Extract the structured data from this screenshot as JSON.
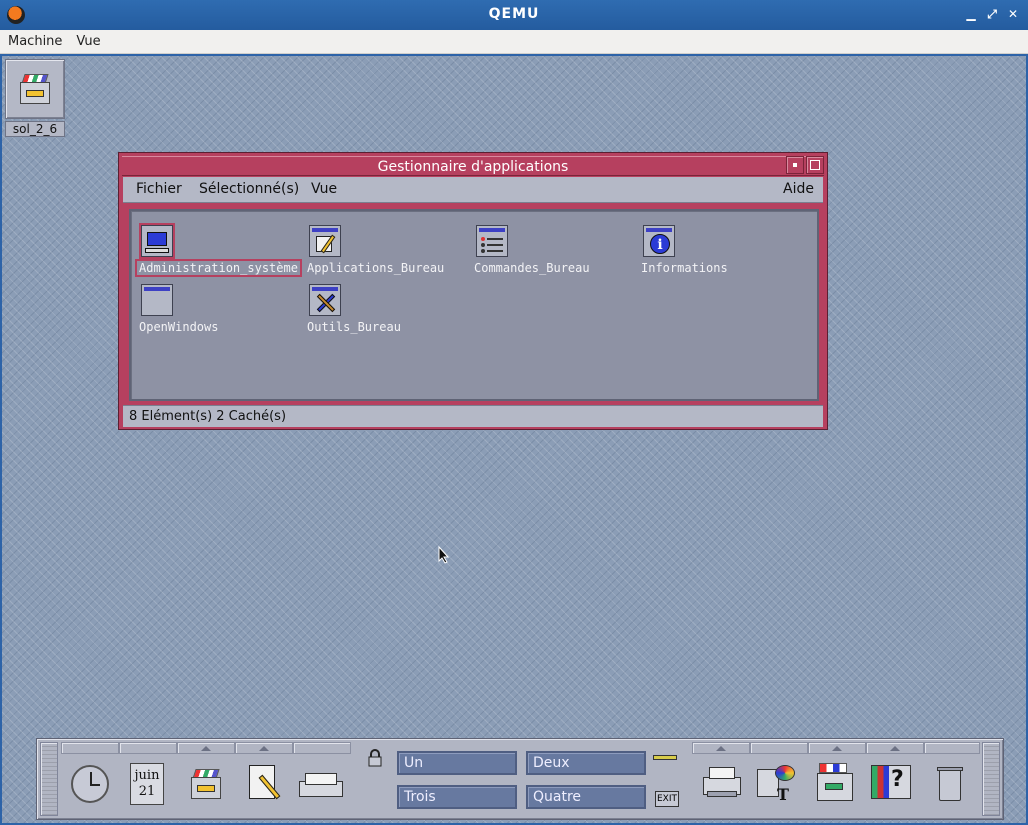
{
  "host": {
    "title": "QEMU",
    "menu": [
      "Machine",
      "Vue"
    ],
    "controls": {
      "minimize": "▁",
      "maximize": "⤢",
      "close": "✕"
    }
  },
  "desktop": {
    "icon_label": "sol_2_6"
  },
  "app_manager": {
    "title": "Gestionnaire d'applications",
    "menu": {
      "file": "Fichier",
      "selected": "Sélectionné(s)",
      "view": "Vue",
      "help": "Aide"
    },
    "items": [
      {
        "label": "Administration_système",
        "icon": "computer-icon",
        "selected": true
      },
      {
        "label": "Applications_Bureau",
        "icon": "notepad-pencil-icon",
        "selected": false
      },
      {
        "label": "Commandes_Bureau",
        "icon": "command-list-icon",
        "selected": false
      },
      {
        "label": "Informations",
        "icon": "info-icon",
        "selected": false
      },
      {
        "label": "OpenWindows",
        "icon": "folder-icon",
        "selected": false
      },
      {
        "label": "Outils_Bureau",
        "icon": "tools-icon",
        "selected": false
      }
    ],
    "status": "8 Elément(s) 2 Caché(s)"
  },
  "front_panel": {
    "calendar": {
      "month": "juin",
      "day": "21"
    },
    "workspaces": [
      "Un",
      "Deux",
      "Trois",
      "Quatre"
    ],
    "exit_label": "EXIT",
    "colors": {
      "panel": "#b1b5c3",
      "workspace": "#6779a0",
      "window_frame": "#b6405f"
    }
  }
}
